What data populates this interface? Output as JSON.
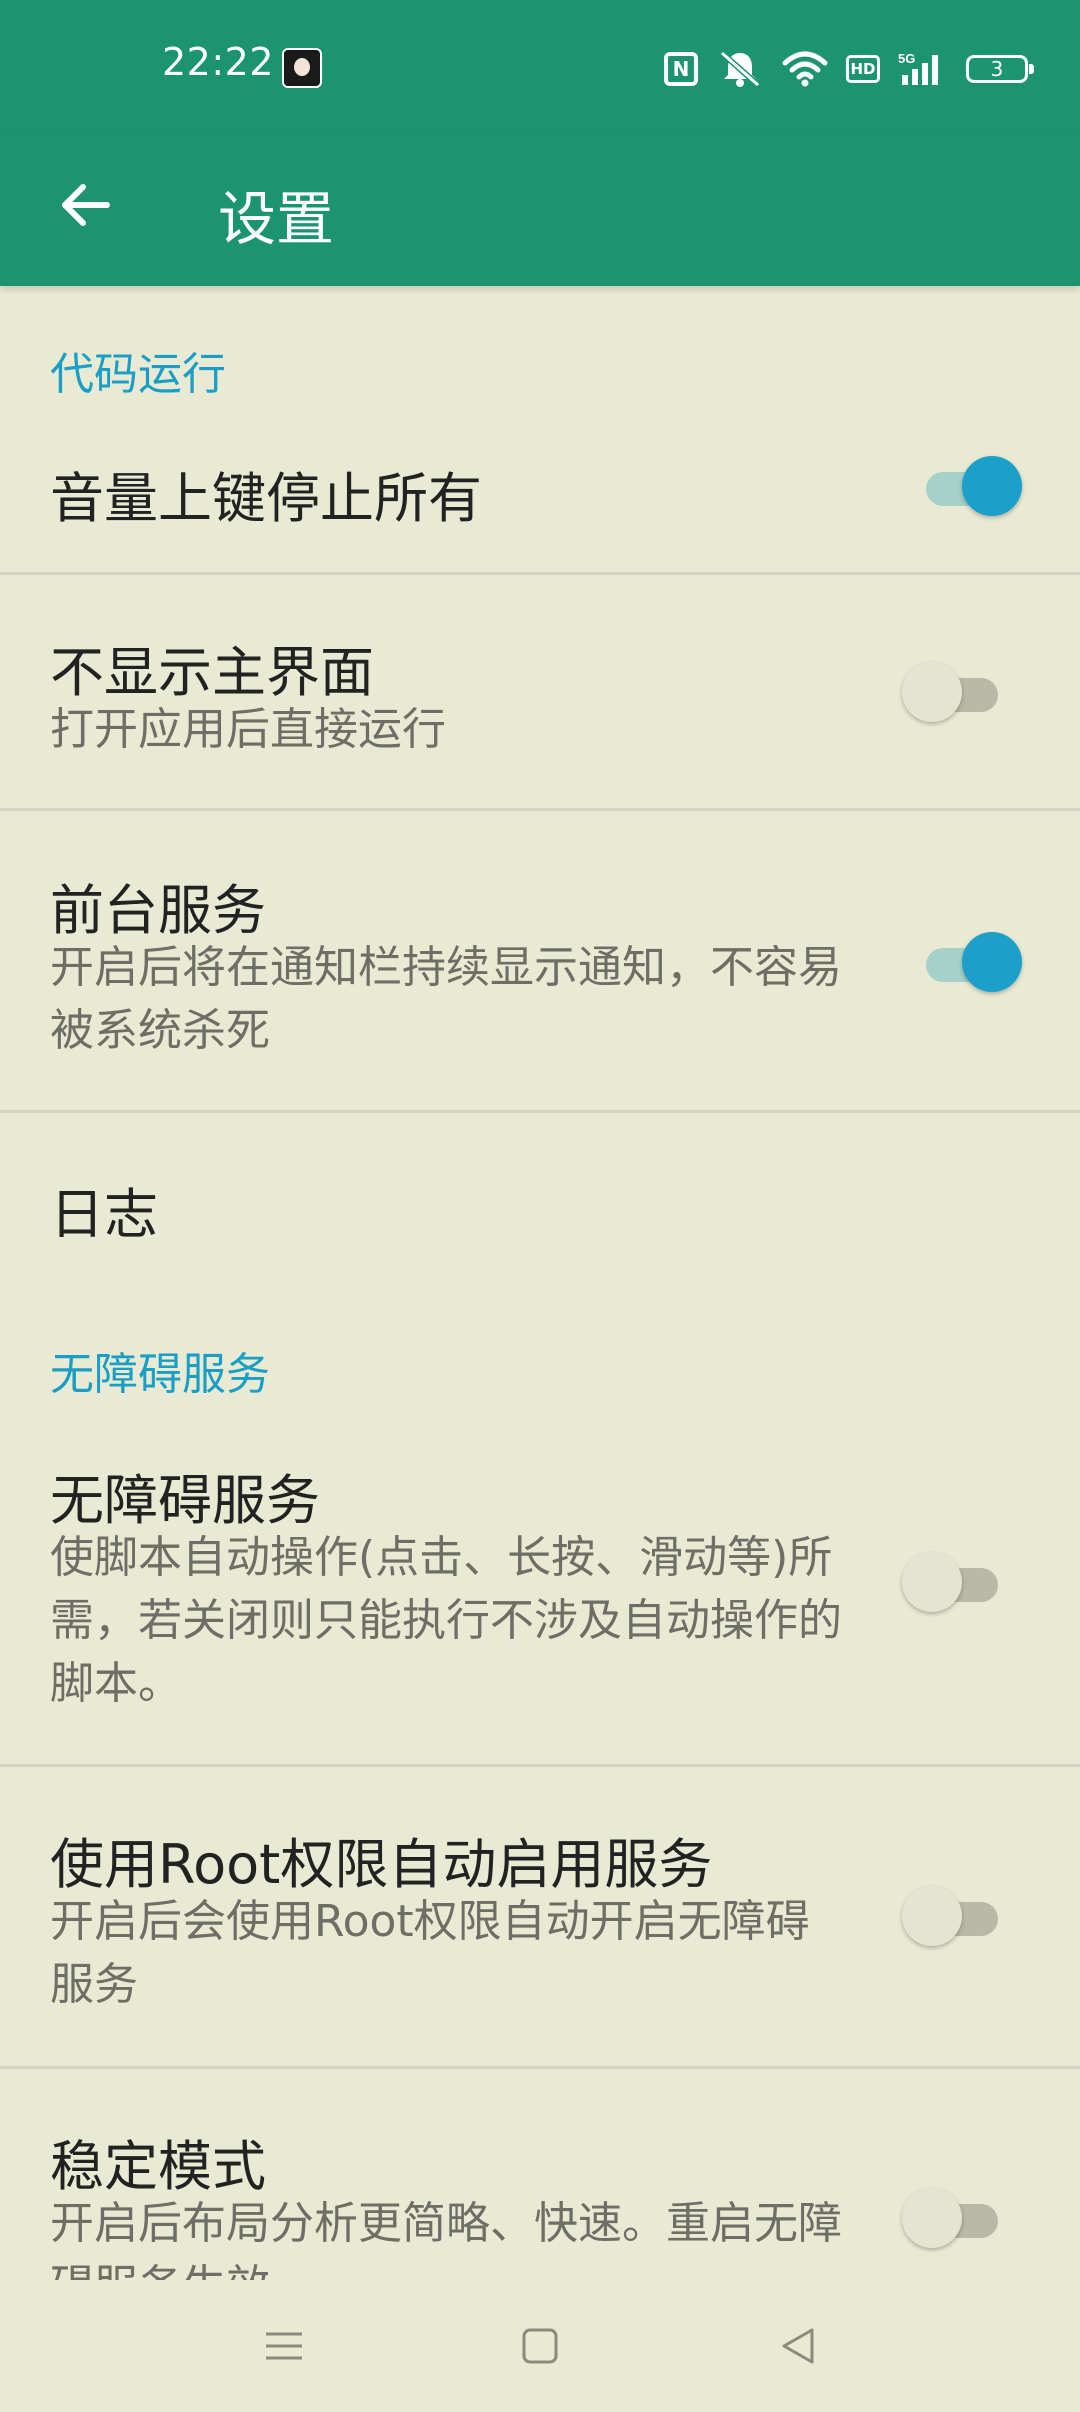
{
  "status_bar": {
    "time": "22:22",
    "battery_level": "3",
    "network": "5G",
    "hd_label": "HD",
    "icons": [
      "avatar-icon",
      "nfc-icon",
      "mute-icon",
      "wifi-icon",
      "hd-icon",
      "signal-5g-icon",
      "battery-icon"
    ]
  },
  "app_bar": {
    "title": "设置",
    "back_icon": "arrow-left-icon",
    "color": "#1d9470"
  },
  "sections": [
    {
      "header": "代码运行",
      "items": [
        {
          "title": "音量上键停止所有",
          "summary": "",
          "enabled": true
        },
        {
          "title": "不显示主界面",
          "summary": "打开应用后直接运行",
          "enabled": false
        },
        {
          "title": "前台服务",
          "summary": "开启后将在通知栏持续显示通知，不容易被系统杀死",
          "enabled": true
        },
        {
          "title": "日志",
          "summary": ""
        }
      ]
    },
    {
      "header": "无障碍服务",
      "items": [
        {
          "title": "无障碍服务",
          "summary": "使脚本自动操作(点击、长按、滑动等)所需，若关闭则只能执行不涉及自动操作的脚本。",
          "enabled": false
        },
        {
          "title": "使用Root权限自动启用服务",
          "summary": "开启后会使用Root权限自动开启无障碍服务",
          "enabled": false
        },
        {
          "title": "稳定模式",
          "summary": "开启后布局分析更简略、快速。重启无障碍服务生效",
          "enabled": false
        }
      ]
    }
  ],
  "nav_bar": {
    "buttons": [
      "menu-icon",
      "home-icon",
      "back-icon"
    ]
  },
  "colors": {
    "primary": "#1d9470",
    "accent": "#1d9fcc",
    "background": "#e8ead3",
    "section_header": "#1b9ec6"
  }
}
